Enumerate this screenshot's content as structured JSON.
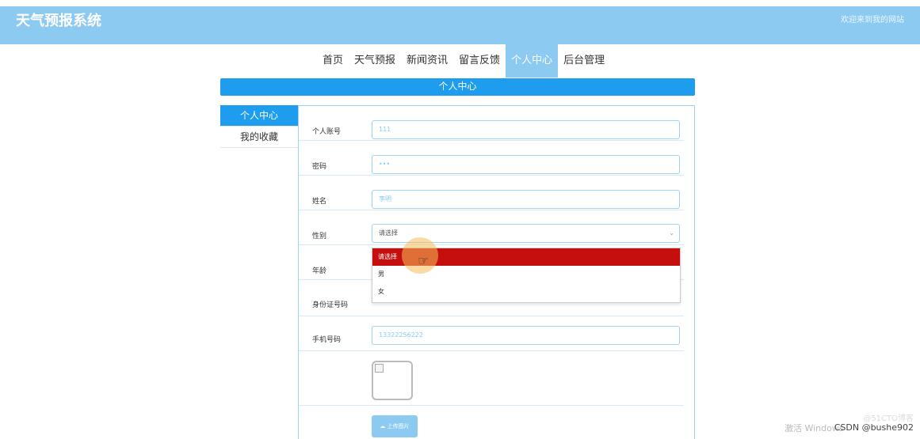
{
  "header": {
    "title": "天气预报系统",
    "welcome": "欢迎来到我的网站"
  },
  "nav": {
    "items": [
      "首页",
      "天气预报",
      "新闻资讯",
      "留言反馈",
      "个人中心",
      "后台管理"
    ],
    "active": "个人中心"
  },
  "banner": {
    "title": "个人中心"
  },
  "sidebar": {
    "items": [
      {
        "label": "个人中心",
        "active": true
      },
      {
        "label": "我的收藏",
        "active": false
      }
    ]
  },
  "form": {
    "account": {
      "label": "个人账号",
      "value": "111"
    },
    "password": {
      "label": "密码",
      "value": "•••"
    },
    "name": {
      "label": "姓名",
      "value": "李明"
    },
    "gender": {
      "label": "性别",
      "value": "请选择",
      "options": [
        "请选择",
        "男",
        "女"
      ],
      "highlighted": "请选择"
    },
    "age": {
      "label": "年龄"
    },
    "id_number": {
      "label": "身份证号码"
    },
    "phone": {
      "label": "手机号码",
      "value": "13322256222"
    },
    "upload_label": "上传图片"
  },
  "watermarks": {
    "csdn": "CSDN @bushe902",
    "blog": "@51CTO博客",
    "activate": "激活 Windows"
  },
  "colors": {
    "header": "#8ccaf2",
    "banner": "#1e9dee",
    "highlight": "#c50e0e"
  }
}
